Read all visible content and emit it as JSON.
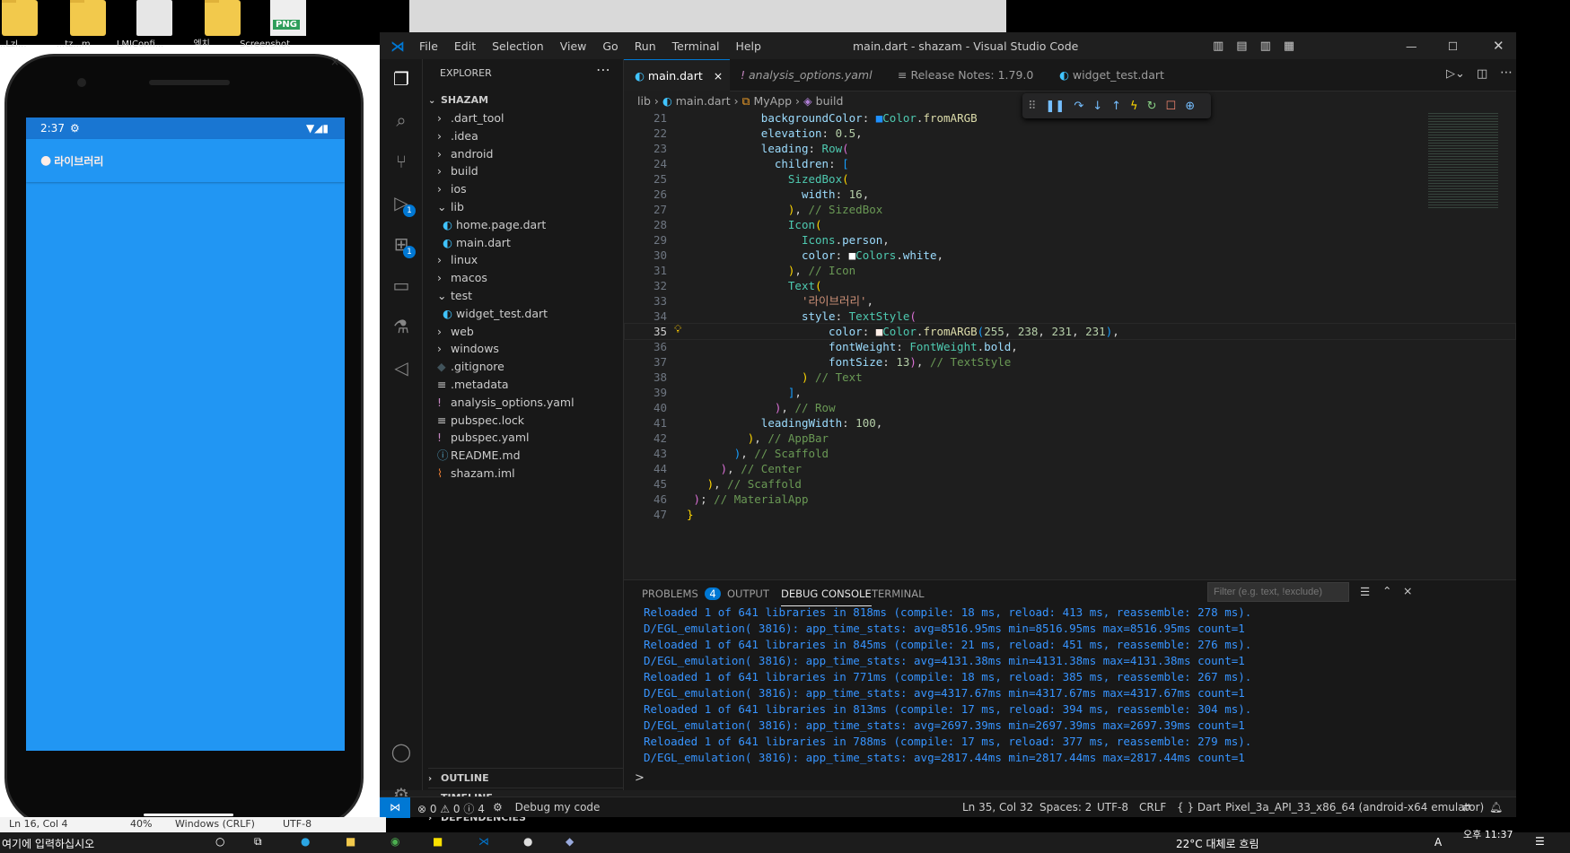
{
  "desktop": {
    "icons": [
      {
        "label": "..Lzl..."
      },
      {
        "label": "...tz...m"
      },
      {
        "label": "LMIConfi..."
      },
      {
        "label": "엑치"
      },
      {
        "label": "Screenshot",
        "badge": "PNG"
      }
    ]
  },
  "phone": {
    "status_time": "2:37",
    "appbar_title": "라이브러리"
  },
  "vscode": {
    "menu": [
      "File",
      "Edit",
      "Selection",
      "View",
      "Go",
      "Run",
      "Terminal",
      "Help"
    ],
    "window_title": "main.dart - shazam - Visual Studio Code",
    "explorer": {
      "header": "EXPLORER",
      "root": "SHAZAM",
      "items": [
        {
          "label": ".dart_tool",
          "kind": "folder-collapsed",
          "depth": 1
        },
        {
          "label": ".idea",
          "kind": "folder-collapsed",
          "depth": 1
        },
        {
          "label": "android",
          "kind": "folder-collapsed",
          "depth": 1
        },
        {
          "label": "build",
          "kind": "folder-collapsed",
          "depth": 1
        },
        {
          "label": "ios",
          "kind": "folder-collapsed",
          "depth": 1
        },
        {
          "label": "lib",
          "kind": "folder-expanded",
          "depth": 1
        },
        {
          "label": "home.page.dart",
          "kind": "dart-file",
          "depth": 2
        },
        {
          "label": "main.dart",
          "kind": "dart-file",
          "depth": 2
        },
        {
          "label": "linux",
          "kind": "folder-collapsed",
          "depth": 1
        },
        {
          "label": "macos",
          "kind": "folder-collapsed",
          "depth": 1
        },
        {
          "label": "test",
          "kind": "folder-expanded",
          "depth": 1
        },
        {
          "label": "widget_test.dart",
          "kind": "dart-file",
          "depth": 2
        },
        {
          "label": "web",
          "kind": "folder-collapsed",
          "depth": 1
        },
        {
          "label": "windows",
          "kind": "folder-collapsed",
          "depth": 1
        },
        {
          "label": ".gitignore",
          "kind": "git-file",
          "depth": 1
        },
        {
          "label": ".metadata",
          "kind": "text-file",
          "depth": 1
        },
        {
          "label": "analysis_options.yaml",
          "kind": "yaml-file",
          "depth": 1
        },
        {
          "label": "pubspec.lock",
          "kind": "text-file",
          "depth": 1
        },
        {
          "label": "pubspec.yaml",
          "kind": "yaml-file",
          "depth": 1
        },
        {
          "label": "README.md",
          "kind": "info-file",
          "depth": 1
        },
        {
          "label": "shazam.iml",
          "kind": "rss-file",
          "depth": 1
        }
      ],
      "sections": [
        "OUTLINE",
        "TIMELINE",
        "DEPENDENCIES"
      ]
    },
    "tabs": [
      {
        "label": "main.dart",
        "active": true
      },
      {
        "label": "analysis_options.yaml",
        "active": false
      },
      {
        "label": "Release Notes: 1.79.0",
        "active": false
      },
      {
        "label": "widget_test.dart",
        "active": false
      }
    ],
    "breadcrumb": [
      "lib",
      "main.dart",
      "MyApp",
      "build"
    ],
    "current_line": 35,
    "code_lines": [
      {
        "n": "21",
        "indent": 11,
        "html": "<span class='p'>backgroundColor</span><span class='t'>: </span><span style='color:#1e90ff'>■</span><span class='k'>Color</span><span class='t'>.</span><span class='f'>fromARGB</span>"
      },
      {
        "n": "22",
        "indent": 11,
        "html": "<span class='p'>elevation</span><span class='t'>: </span><span class='n'>0.5</span><span class='t'>,</span>"
      },
      {
        "n": "23",
        "indent": 11,
        "html": "<span class='p'>leading</span><span class='t'>: </span><span class='k'>Row</span><span style='color:#da70d6'>(</span>"
      },
      {
        "n": "24",
        "indent": 13,
        "html": "<span class='p'>children</span><span class='t'>: </span><span style='color:#179fff'>[</span>"
      },
      {
        "n": "25",
        "indent": 15,
        "html": "<span class='k'>SizedBox</span><span style='color:#ffd700'>(</span>"
      },
      {
        "n": "26",
        "indent": 17,
        "html": "<span class='p'>width</span><span class='t'>: </span><span class='n'>16</span><span class='t'>,</span>"
      },
      {
        "n": "27",
        "indent": 15,
        "html": "<span style='color:#ffd700'>)</span><span class='t'>, </span><span class='c'>// SizedBox</span>"
      },
      {
        "n": "28",
        "indent": 15,
        "html": "<span class='k'>Icon</span><span style='color:#ffd700'>(</span>"
      },
      {
        "n": "29",
        "indent": 17,
        "html": "<span class='k'>Icons</span><span class='t'>.</span><span class='p'>person</span><span class='t'>,</span>"
      },
      {
        "n": "30",
        "indent": 17,
        "html": "<span class='p'>color</span><span class='t'>: </span><span style='color:#fff'>■</span><span class='k'>Colors</span><span class='t'>.</span><span class='p'>white</span><span class='t'>,</span>"
      },
      {
        "n": "31",
        "indent": 15,
        "html": "<span style='color:#ffd700'>)</span><span class='t'>, </span><span class='c'>// Icon</span>"
      },
      {
        "n": "32",
        "indent": 15,
        "html": "<span class='k'>Text</span><span style='color:#ffd700'>(</span>"
      },
      {
        "n": "33",
        "indent": 17,
        "html": "<span class='s'>'라이브러리'</span><span class='t'>,</span>"
      },
      {
        "n": "34",
        "indent": 17,
        "html": "<span class='p'>style</span><span class='t'>: </span><span class='k'>TextStyle</span><span style='color:#da70d6'>(</span>"
      },
      {
        "n": "35",
        "indent": 21,
        "html": "<span class='p'>color</span><span class='t'>: </span><span style='color:#ffeee7'>■</span><span class='k'>Color</span><span class='t'>.</span><span class='f'>fromARGB</span><span style='color:#179fff'>(</span><span class='n'>255</span><span class='t'>, </span><span class='n'>238</span><span class='t'>, </span><span class='n'>231</span><span class='t'>, </span><span class='n'>231</span><span style='color:#179fff'>)</span><span class='t'>,</span>"
      },
      {
        "n": "36",
        "indent": 21,
        "html": "<span class='p'>fontWeight</span><span class='t'>: </span><span class='k'>FontWeight</span><span class='t'>.</span><span class='p'>bold</span><span class='t'>,</span>"
      },
      {
        "n": "37",
        "indent": 21,
        "html": "<span class='p'>fontSize</span><span class='t'>: </span><span class='n'>13</span><span style='color:#da70d6'>)</span><span class='t'>, </span><span class='c'>// TextStyle</span>"
      },
      {
        "n": "38",
        "indent": 17,
        "html": "<span style='color:#ffd700'>)</span><span class='t'> </span><span class='c'>// Text</span>"
      },
      {
        "n": "39",
        "indent": 15,
        "html": "<span style='color:#179fff'>]</span><span class='t'>,</span>"
      },
      {
        "n": "40",
        "indent": 13,
        "html": "<span style='color:#da70d6'>)</span><span class='t'>, </span><span class='c'>// Row</span>"
      },
      {
        "n": "41",
        "indent": 11,
        "html": "<span class='p'>leadingWidth</span><span class='t'>: </span><span class='n'>100</span><span class='t'>,</span>"
      },
      {
        "n": "42",
        "indent": 9,
        "html": "<span style='color:#ffd700'>)</span><span class='t'>, </span><span class='c'>// AppBar</span>"
      },
      {
        "n": "43",
        "indent": 7,
        "html": "<span style='color:#179fff'>)</span><span class='t'>, </span><span class='c'>// Scaffold</span>"
      },
      {
        "n": "44",
        "indent": 5,
        "html": "<span style='color:#da70d6'>)</span><span class='t'>, </span><span class='c'>// Center</span>"
      },
      {
        "n": "45",
        "indent": 3,
        "html": "<span style='color:#ffd700'>)</span><span class='t'>, </span><span class='c'>// Scaffold</span>"
      },
      {
        "n": "46",
        "indent": 1,
        "html": "<span style='color:#da70d6'>)</span><span class='t'>; </span><span class='c'>// MaterialApp</span>"
      },
      {
        "n": "47",
        "indent": 0,
        "html": "<span style='color:#ffd700'>}</span>"
      }
    ],
    "panel": {
      "tabs": [
        "PROBLEMS",
        "OUTPUT",
        "DEBUG CONSOLE",
        "TERMINAL"
      ],
      "problems_count": "4",
      "active_tab": "DEBUG CONSOLE",
      "filter_placeholder": "Filter (e.g. text, !exclude)",
      "logs": [
        "Reloaded 1 of 641 libraries in 818ms (compile: 18 ms, reload: 413 ms, reassemble: 278 ms).",
        "D/EGL_emulation( 3816): app_time_stats: avg=8516.95ms min=8516.95ms max=8516.95ms count=1",
        "Reloaded 1 of 641 libraries in 845ms (compile: 21 ms, reload: 451 ms, reassemble: 276 ms).",
        "D/EGL_emulation( 3816): app_time_stats: avg=4131.38ms min=4131.38ms max=4131.38ms count=1",
        "Reloaded 1 of 641 libraries in 771ms (compile: 18 ms, reload: 385 ms, reassemble: 267 ms).",
        "D/EGL_emulation( 3816): app_time_stats: avg=4317.67ms min=4317.67ms max=4317.67ms count=1",
        "Reloaded 1 of 641 libraries in 813ms (compile: 17 ms, reload: 394 ms, reassemble: 304 ms).",
        "D/EGL_emulation( 3816): app_time_stats: avg=2697.39ms min=2697.39ms max=2697.39ms count=1",
        "Reloaded 1 of 641 libraries in 788ms (compile: 17 ms, reload: 377 ms, reassemble: 279 ms).",
        "D/EGL_emulation( 3816): app_time_stats: avg=2817.44ms min=2817.44ms max=2817.44ms count=1"
      ],
      "prompt": ">"
    },
    "status": {
      "errors": "0",
      "warnings": "0",
      "infos": "4",
      "debug_label": "Debug my code",
      "position": "Ln 35, Col 32",
      "spaces": "Spaces: 2",
      "encoding": "UTF-8",
      "eol": "CRLF",
      "language": "Dart",
      "device": "Pixel_3a_API_33_x86_64 (android-x64 emulator)"
    }
  },
  "below_phone": {
    "cursor_pos": "Ln 16, Col 4",
    "zoom": "40%",
    "eol": "Windows (CRLF)",
    "encoding": "UTF-8"
  },
  "taskbar": {
    "search_hint": "여기에 입력하십시오",
    "weather": "22°C 대체로 흐림",
    "ime": "A",
    "clock": "오후 11:37"
  }
}
